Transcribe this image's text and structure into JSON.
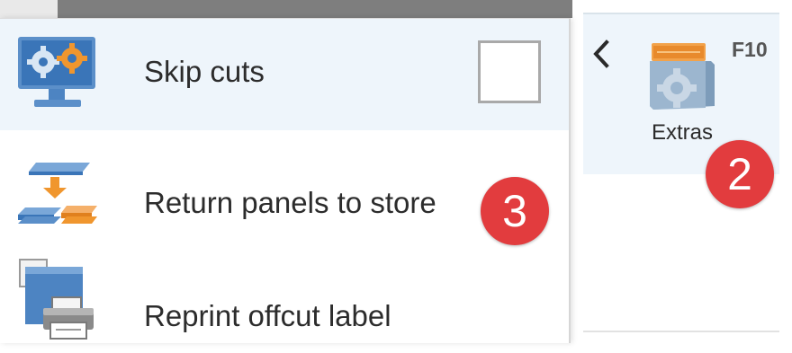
{
  "ribbon": {
    "extras_label": "Extras",
    "extras_shortcut": "F10",
    "badge": "2"
  },
  "menu": {
    "items": [
      {
        "label": "Skip cuts",
        "icon": "monitor-gears-icon",
        "checked": false
      },
      {
        "label": "Return panels to store",
        "icon": "return-panels-icon",
        "badge": "3"
      },
      {
        "label": "Reprint offcut label",
        "icon": "printer-icon"
      }
    ]
  },
  "colors": {
    "highlight": "#eef5fb",
    "badge": "#e23c3e",
    "accent_blue": "#3a7cc7",
    "accent_orange": "#f0962e"
  }
}
